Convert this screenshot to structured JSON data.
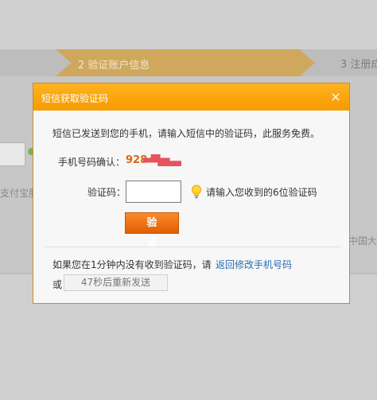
{
  "background": {
    "step2_label": "2 验证账户信息",
    "step3_label": "3 注册成",
    "left_text": "支付宝服",
    "right_text": "中国大"
  },
  "dialog": {
    "title": "短信获取验证码",
    "close_symbol": "×",
    "message": "短信已发送到您的手机，请输入短信中的验证码，此服务免费。",
    "phone_label": "手机号码确认：",
    "phone_value": "928",
    "code_label": "验证码：",
    "code_value": "",
    "hint": "请输入您收到的6位验证码",
    "verify_label": "验 证",
    "footer_text": "如果您在1分钟内没有收到验证码，请",
    "footer_link": "返回修改手机号码",
    "or_text": "或",
    "resend_label": "47秒后重新发送"
  },
  "colors": {
    "header": "#f9a206",
    "verify_button": "#ef6f10",
    "link": "#2a6ab3",
    "phone": "#e16415"
  },
  "icons": {
    "close": "close-icon",
    "hint": "lightbulb-icon"
  }
}
